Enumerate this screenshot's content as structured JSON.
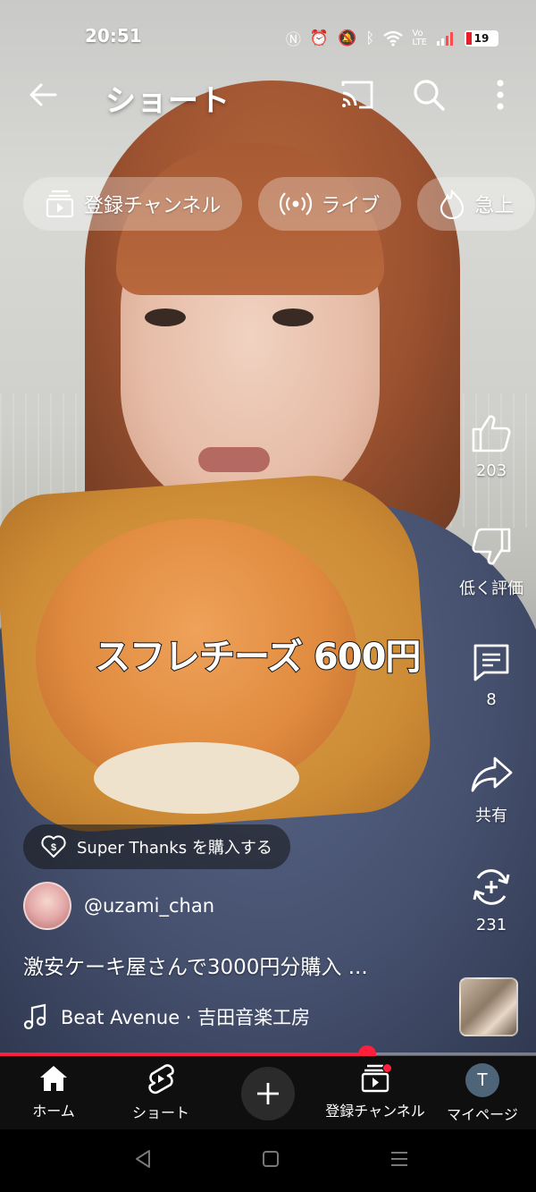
{
  "status_bar": {
    "time": "20:51",
    "battery": "19",
    "battery_level": 0.19
  },
  "app_bar": {
    "title": "ショート"
  },
  "chips": [
    {
      "icon": "subscriptions-icon",
      "label": "登録チャンネル"
    },
    {
      "icon": "live-icon",
      "label": "ライブ"
    },
    {
      "icon": "trending-icon",
      "label": "急上"
    }
  ],
  "video": {
    "caption_overlay": "スフレチーズ 600円"
  },
  "actions": {
    "like_count": "203",
    "dislike_label": "低く評価",
    "comment_count": "8",
    "share_label": "共有",
    "remix_count": "231"
  },
  "super_thanks": {
    "label": "Super Thanks を購入する"
  },
  "channel": {
    "handle": "@uzami_chan"
  },
  "description": "激安ケーキ屋さんで3000円分購入 ...",
  "music": {
    "label": "Beat Avenue · 吉田音楽工房"
  },
  "progress": {
    "played_fraction": 0.685
  },
  "bottom_nav": {
    "home": "ホーム",
    "shorts": "ショート",
    "subscriptions": "登録チャンネル",
    "mypage": "マイページ",
    "profile_initial": "T"
  },
  "colors": {
    "accent_red": "#ff1e3c",
    "nav_background": "#0f0f0f"
  }
}
